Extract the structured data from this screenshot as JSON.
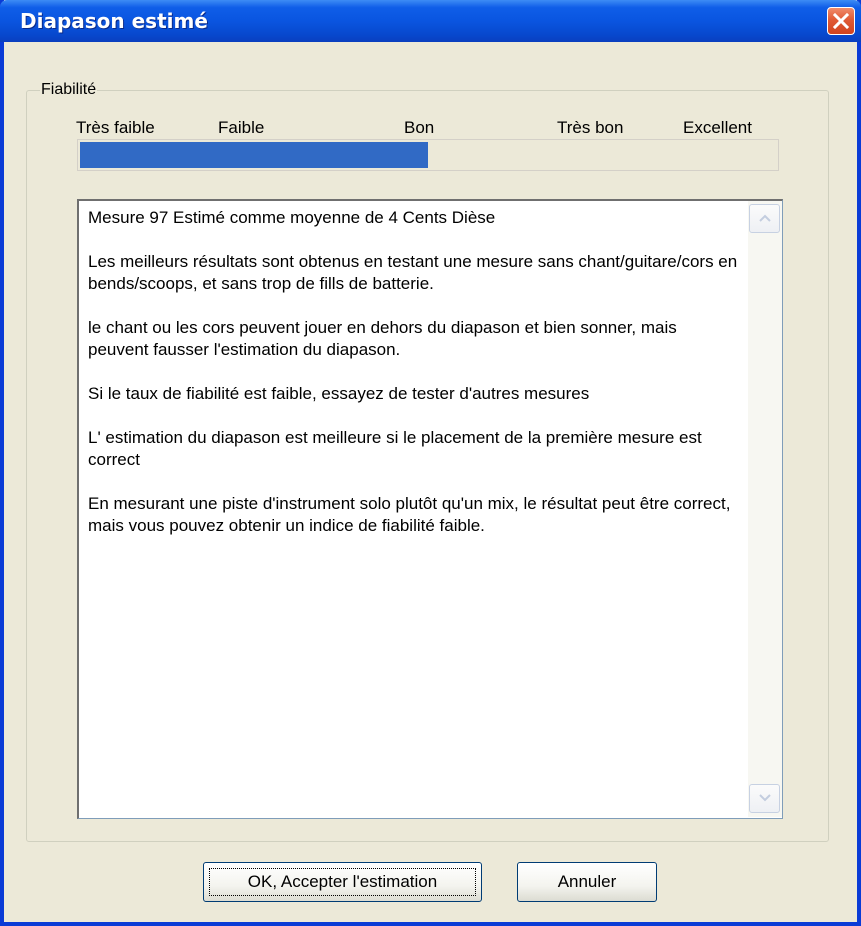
{
  "window": {
    "title": "Diapason estimé"
  },
  "reliability": {
    "group_label": "Fiabilité",
    "scale_labels": [
      "Très faible",
      "Faible",
      "Bon",
      "Très bon",
      "Excellent"
    ],
    "level_fraction": 0.5
  },
  "message": {
    "paragraphs": [
      "Mesure 97 Estimé comme moyenne de 4 Cents Dièse",
      "Les meilleurs résultats sont obtenus en testant une mesure sans chant/guitare/cors en bends/scoops, et sans trop de fills de batterie.",
      "le chant ou les cors peuvent jouer en dehors du diapason et bien sonner, mais peuvent fausser l'estimation du diapason.",
      "Si le taux de fiabilité est faible, essayez de tester d'autres mesures",
      "L' estimation du diapason est meilleure si le placement de la première mesure est correct",
      "En mesurant une piste d'instrument solo plutôt qu'un mix, le résultat peut être correct, mais vous pouvez obtenir un indice de fiabilité faible."
    ]
  },
  "buttons": {
    "ok_label": "OK, Accepter l'estimation",
    "cancel_label": "Annuler"
  },
  "icons": {
    "close": "close-icon",
    "scroll_up": "scroll-up-icon",
    "scroll_down": "scroll-down-icon"
  },
  "colors": {
    "title_bar": "#0a55e0",
    "meter_fill": "#316ac5",
    "close_button": "#e05a35"
  }
}
